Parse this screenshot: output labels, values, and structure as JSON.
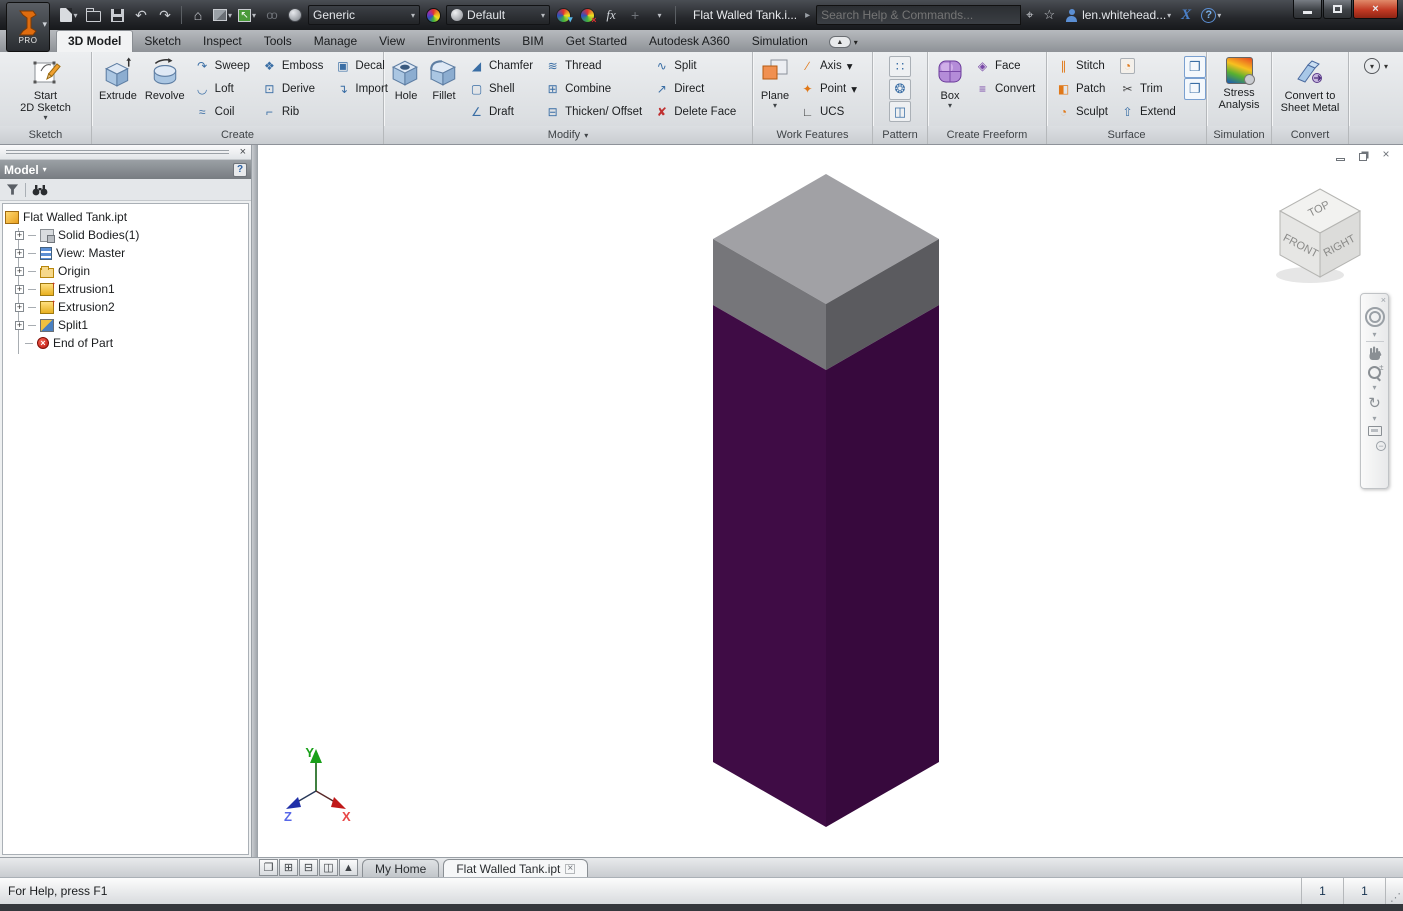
{
  "titlebar": {
    "brand": "PRO",
    "material_combo": "Generic",
    "appearance_combo": "Default",
    "title": "Flat Walled Tank.i...",
    "search_placeholder": "Search Help & Commands...",
    "user": "len.whitehead...",
    "help": "?"
  },
  "ribbon_tabs": {
    "active": "3D Model",
    "items": [
      "3D Model",
      "Sketch",
      "Inspect",
      "Tools",
      "Manage",
      "View",
      "Environments",
      "BIM",
      "Get Started",
      "Autodesk A360",
      "Simulation"
    ]
  },
  "ribbon": {
    "sketch": {
      "panel": "Sketch",
      "start1": "Start",
      "start2": "2D Sketch"
    },
    "create": {
      "panel": "Create",
      "extrude": "Extrude",
      "revolve": "Revolve",
      "col1": [
        "Sweep",
        "Loft",
        "Coil"
      ],
      "col2": [
        "Emboss",
        "Derive",
        "Rib"
      ],
      "col3": [
        "Decal",
        "Import"
      ]
    },
    "modify": {
      "panel": "Modify",
      "hole": "Hole",
      "fillet": "Fillet",
      "col1": [
        "Chamfer",
        "Shell",
        "Draft"
      ],
      "col2": [
        "Thread",
        "Combine",
        "Thicken/ Offset"
      ],
      "col3": [
        "Split",
        "Direct",
        "Delete Face"
      ]
    },
    "work": {
      "panel": "Work Features",
      "plane": "Plane",
      "col": [
        "Axis",
        "Point",
        "UCS"
      ]
    },
    "pattern": {
      "panel": "Pattern"
    },
    "freeform": {
      "panel": "Create Freeform",
      "box": "Box",
      "col": [
        "Face",
        "Convert"
      ]
    },
    "surface": {
      "panel": "Surface",
      "col1": [
        "Stitch",
        "Patch",
        "Sculpt"
      ],
      "col2": [
        "Trim",
        "Extend"
      ]
    },
    "simulation": {
      "panel": "Simulation",
      "line1": "Stress",
      "line2": "Analysis"
    },
    "convert": {
      "panel": "Convert",
      "line1": "Convert to",
      "line2": "Sheet Metal"
    }
  },
  "browser": {
    "header": "Model",
    "tree": [
      {
        "label": "Flat Walled Tank.ipt"
      },
      {
        "label": "Solid Bodies(1)"
      },
      {
        "label": "View: Master"
      },
      {
        "label": "Origin"
      },
      {
        "label": "Extrusion1"
      },
      {
        "label": "Extrusion2"
      },
      {
        "label": "Split1"
      },
      {
        "label": "End of Part"
      }
    ]
  },
  "viewcube": {
    "top": "TOP",
    "front": "FRONT",
    "right": "RIGHT"
  },
  "doc_tabs": {
    "items": [
      "My Home",
      "Flat Walled Tank.ipt"
    ],
    "active": "Flat Walled Tank.ipt"
  },
  "statusbar": {
    "message": "For Help, press F1",
    "cell1": "1",
    "cell2": "1"
  },
  "triad": {
    "x": "X",
    "y": "Y",
    "z": "Z"
  },
  "colors": {
    "model_top": "#a1a1a5",
    "model_gray_left": "#76767a",
    "model_gray_right": "#5b5b5f",
    "model_purple_left": "#3f0c45",
    "model_purple_right": "#37093d",
    "accent_orange": "#e06c0e"
  },
  "icons": {
    "dropdown": "▾",
    "undo": "↶",
    "redo": "↷",
    "home": "⌂",
    "select": "↖",
    "fx": "fx",
    "plus": "+",
    "satellite": "⌖",
    "star": "☆",
    "exchange": "X",
    "help": "?",
    "sweep": "↷",
    "loft": "◡",
    "coil": "≈",
    "emboss": "❖",
    "derive": "⊡",
    "rib": "⌐",
    "decal": "▣",
    "import": "↴",
    "chamfer": "◢",
    "shell": "▢",
    "draft": "∠",
    "thread": "≋",
    "combine": "⊞",
    "thicken": "⊟",
    "split": "∿",
    "direct": "↗",
    "delete_face": "✘",
    "axis": "∕",
    "point": "✦",
    "ucs": "∟",
    "face": "◈",
    "freeform_convert": "≡",
    "stitch": "∥",
    "patch": "◧",
    "sculpt": "◔",
    "trim": "✂",
    "extend": "⇧",
    "pattern_rect": "∷",
    "pattern_circular": "❂",
    "pattern_mirror": "◫",
    "surface_a": "❒",
    "surface_b": "❐",
    "orbit": "↻",
    "close": "×",
    "expand": "+",
    "collapse_pill": "▲"
  }
}
